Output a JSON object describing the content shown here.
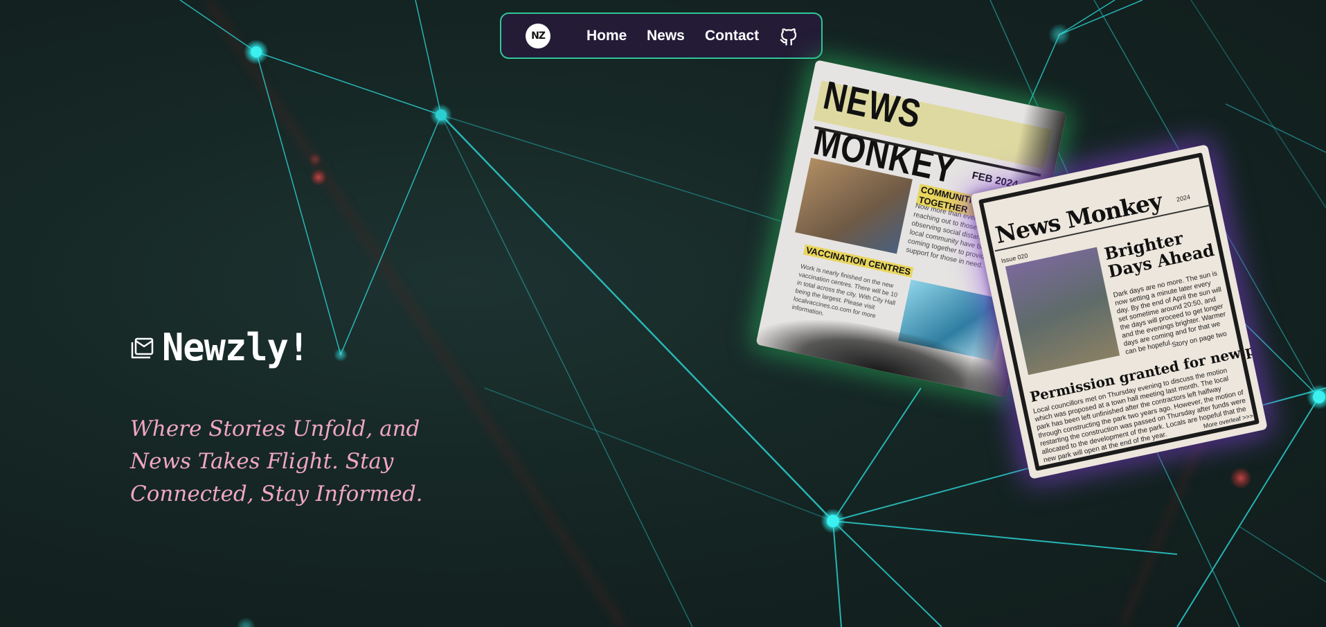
{
  "navbar": {
    "logo_text": "NZ",
    "links": [
      "Home",
      "News",
      "Contact"
    ],
    "github_icon": "github-icon"
  },
  "hero": {
    "brand_name": "Newzly!",
    "brand_icon": "newspaper-stack-icon",
    "tagline": "Where Stories Unfold, and News Takes Flight. Stay Connected, Stay Informed."
  },
  "newspaper_left": {
    "masthead": "NEWS MONKEY",
    "date": "FEB 2024",
    "headline_1": "COMMUNITIES COMING TOGETHER",
    "body_1": "Now more than ever people are reaching out to those in need. Still observing social distancing rules, the local community have been active in coming together to provide food and support for those in need.",
    "headline_2": "VACCINATION CENTRES",
    "body_2": "Work is nearly finished on the new vaccination centres. There will be 10 in total across the city. With City Hall being the largest. Please visit localvaccines.co.com for more information."
  },
  "newspaper_right": {
    "masthead": "News Monkey",
    "date": "2024",
    "issue": "Issue 020",
    "headline_1": "Brighter Days Ahead",
    "body_1": "Dark days are no more. The sun is now setting a minute later every day. By the end of April the sun will set sometime around 20:50, and the days will proceed to get longer and the evenings brighter. Warmer days are coming and for that we can be hopeful.",
    "more": "Story on page two",
    "headline_2": "Permission granted for new park",
    "body_2": "Local councillors met on Thursday evening to discuss the motion which was proposed at a town hall meeting last month. The local park has been left unfinished after the contractors left halfway through constructing the park two years ago. However, the motion of restarting the construction was passed on Thursday after funds were allocated to the development of the park. Locals are hopeful that the new park will open at the end of the year.",
    "overleaf": "More overleaf >>>"
  },
  "colors": {
    "nav_bg": "#241c37",
    "nav_border": "#2fc79a",
    "tagline": "#f0a6c3",
    "network_line": "#2ee6e6",
    "glow_green": "#30cd6e",
    "glow_purple": "#8c46e6"
  }
}
